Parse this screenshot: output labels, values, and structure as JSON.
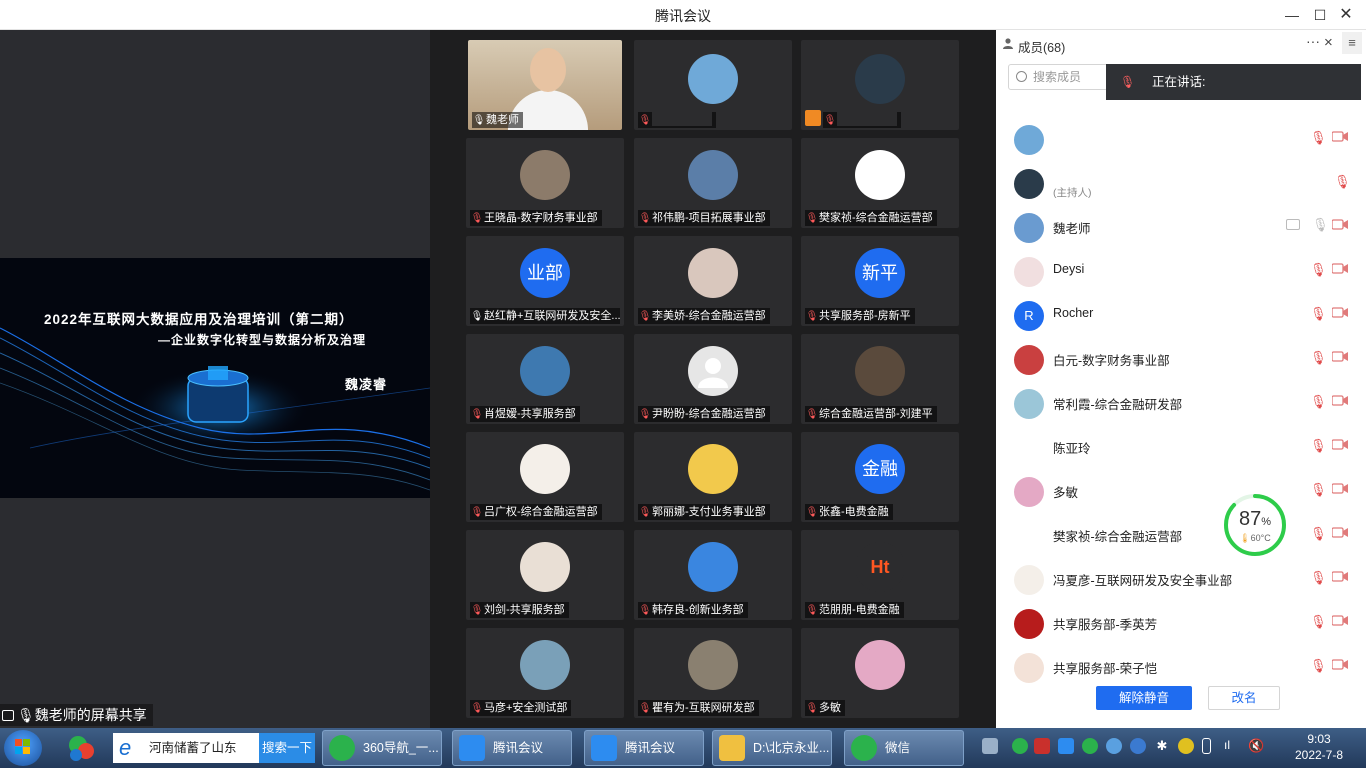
{
  "window": {
    "title": "腾讯会议"
  },
  "share": {
    "slide_title": "2022年互联网大数据应用及治理培训（第二期）",
    "slide_subtitle": "—企业数字化转型与数据分析及治理",
    "slide_presenter": "魏凌睿",
    "label": "魏老师的屏幕共享"
  },
  "tiles": [
    {
      "name": "魏老师",
      "avatar": "video-feed",
      "muted": false
    },
    {
      "name": "",
      "avatar": "landscape",
      "muted": true
    },
    {
      "name": "",
      "avatar": "girl-photo",
      "muted": true
    },
    {
      "name": "王晓晶-数字财务事业部",
      "avatar": "cat",
      "muted": true
    },
    {
      "name": "祁伟鹏-项目拓展事业部",
      "avatar": "building",
      "muted": true
    },
    {
      "name": "樊家祯-综合金融运营部",
      "avatar": "cartoon",
      "muted": true
    },
    {
      "name": "赵红静+互联网研发及安全...",
      "avatar_text": "业部",
      "muted": false
    },
    {
      "name": "李美娇-综合金融运营部",
      "avatar": "hand",
      "muted": true
    },
    {
      "name": "共享服务部-房新平",
      "avatar_text": "新平",
      "muted": true
    },
    {
      "name": "肖煜嫒-共享服务部",
      "avatar": "lake",
      "muted": true
    },
    {
      "name": "尹盼盼-综合金融运营部",
      "avatar": "default",
      "muted": true
    },
    {
      "name": "综合金融运营部-刘建平",
      "avatar": "climb",
      "muted": true
    },
    {
      "name": "吕广权-综合金融运营部",
      "avatar": "couple",
      "muted": true
    },
    {
      "name": "郭丽娜-支付业务事业部",
      "avatar": "fish",
      "muted": true
    },
    {
      "name": "张鑫-电费金融",
      "avatar_text": "金融",
      "muted": true
    },
    {
      "name": "刘剑-共享服务部",
      "avatar": "cartoon-boy",
      "muted": true
    },
    {
      "name": "韩存良-创新业务部",
      "avatar": "blue",
      "muted": true
    },
    {
      "name": "范朋朋-电费金融",
      "avatar": "ht-logo",
      "muted": true
    },
    {
      "name": "马彦+安全测试部",
      "avatar": "sunset",
      "muted": true
    },
    {
      "name": "瞿有为-互联网研发部",
      "avatar": "rock",
      "muted": true
    },
    {
      "name": "多敏",
      "avatar": "pink",
      "muted": true
    }
  ],
  "panel": {
    "header": "成员(68)",
    "more": "···",
    "close": "×",
    "menu": "≡",
    "search_placeholder": "搜索成员",
    "speaking_label": "正在讲话:",
    "members": [
      {
        "name": "",
        "sub": "",
        "avatar": "landscape",
        "state": "muted"
      },
      {
        "name": "",
        "sub": "(主持人)",
        "avatar": "girl-photo",
        "state": "muted-only"
      },
      {
        "name": "魏老师",
        "sub": "",
        "avatar": "sky",
        "state": "active"
      },
      {
        "name": "Deysi",
        "sub": "",
        "avatar": "girl2",
        "state": "muted"
      },
      {
        "name": "Rocher",
        "sub": "",
        "avatar_text": "R",
        "state": "muted"
      },
      {
        "name": "白元-数字财务事业部",
        "sub": "",
        "avatar": "red",
        "state": "muted"
      },
      {
        "name": "常利霞-综合金融研发部",
        "sub": "",
        "avatar": "sea",
        "state": "muted"
      },
      {
        "name": "陈亚玲",
        "sub": "",
        "avatar": "person",
        "state": "muted"
      },
      {
        "name": "多敏",
        "sub": "",
        "avatar": "pink",
        "state": "muted"
      },
      {
        "name": "樊家祯-综合金融运营部",
        "sub": "",
        "avatar": "cartoon",
        "state": "muted"
      },
      {
        "name": "冯夏彦-互联网研发及安全事业部",
        "sub": "",
        "avatar": "couple",
        "state": "muted"
      },
      {
        "name": "共享服务部-季英芳",
        "sub": "",
        "avatar": "red2",
        "state": "muted"
      },
      {
        "name": "共享服务部-荣子恺",
        "sub": "",
        "avatar": "kid",
        "state": "muted"
      }
    ],
    "gauge": {
      "value": "87",
      "unit": "%",
      "temp": "60°C",
      "fraction": 0.87,
      "color": "#2ecc4a"
    },
    "unmute_button": "解除静音",
    "rename_button": "改名"
  },
  "taskbar": {
    "search_text": "河南储蓄了山东",
    "search_button": "搜索一下",
    "tasks": [
      "360导航_一...",
      "腾讯会议",
      "腾讯会议",
      "D:\\北京永业...",
      "微信"
    ],
    "time": "9:03",
    "date": "2022-7-8"
  },
  "colors": {
    "accent": "#1f6cf0",
    "muted": "#e04a4a"
  }
}
